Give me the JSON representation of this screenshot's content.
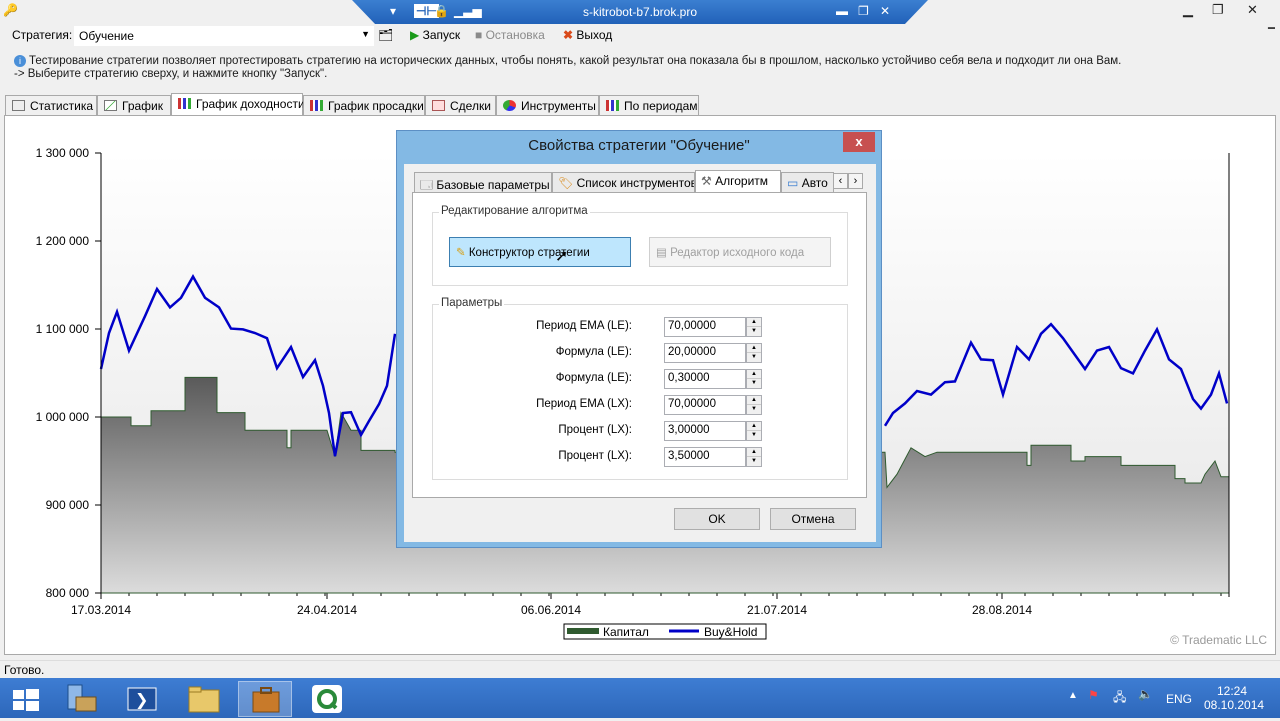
{
  "remote_title": "s-kitrobot-b7.brok.pro",
  "toolbar": {
    "strategy_label": "Стратегия:",
    "strategy_value": "Обучение",
    "start_label": "Запуск",
    "stop_label": "Остановка",
    "exit_label": "Выход"
  },
  "info": {
    "line1": "Тестирование стратегии позволяет протестировать стратегию на исторических данных, чтобы понять, какой результат она показала бы в прошлом, насколько устойчиво себя вела и подходит ли она Вам.",
    "line2": "-> Выберите стратегию сверху, и нажмите кнопку \"Запуск\"."
  },
  "tabs": [
    "Статистика",
    "График",
    "График доходности",
    "График просадки",
    "Сделки",
    "Инструменты",
    "По периодам"
  ],
  "active_tab": "График доходности",
  "chart_data": {
    "type": "area",
    "y_ticks": [
      "1 300 000",
      "1 200 000",
      "1 100 000",
      "1 000 000",
      "900 000",
      "800 000"
    ],
    "x_ticks": [
      "17.03.2014",
      "24.04.2014",
      "06.06.2014",
      "21.07.2014",
      "28.08.2014"
    ],
    "ylim": [
      800000,
      1300000
    ],
    "series": [
      {
        "name": "Капитал",
        "color": "#2f5a2f"
      },
      {
        "name": "Buy&Hold",
        "color": "#0000c8"
      }
    ],
    "copyright": "© Tradematic LLC"
  },
  "dialog": {
    "title": "Свойства стратегии \"Обучение\"",
    "close": "x",
    "tabs": [
      "Базовые параметры",
      "Список инструментов",
      "Алгоритм",
      "Авто"
    ],
    "active_tab": "Алгоритм",
    "algo_group": "Редактирование алгоритма",
    "constructor_button": "Конструктор стратегии",
    "source_editor_button": "Редактор исходного кода",
    "params_group": "Параметры",
    "params": [
      {
        "label": "Период EMA (LE):",
        "value": "70,00000"
      },
      {
        "label": "Формула (LE):",
        "value": "20,00000"
      },
      {
        "label": "Формула (LE):",
        "value": "0,30000"
      },
      {
        "label": "Период EMA (LX):",
        "value": "70,00000"
      },
      {
        "label": "Процент (LX):",
        "value": "3,00000"
      },
      {
        "label": "Процент (LX):",
        "value": "3,50000"
      }
    ],
    "ok": "OK",
    "cancel": "Отмена"
  },
  "status": "Готово.",
  "taskbar": {
    "lang": "ENG",
    "time": "12:24",
    "date": "08.10.2014"
  }
}
